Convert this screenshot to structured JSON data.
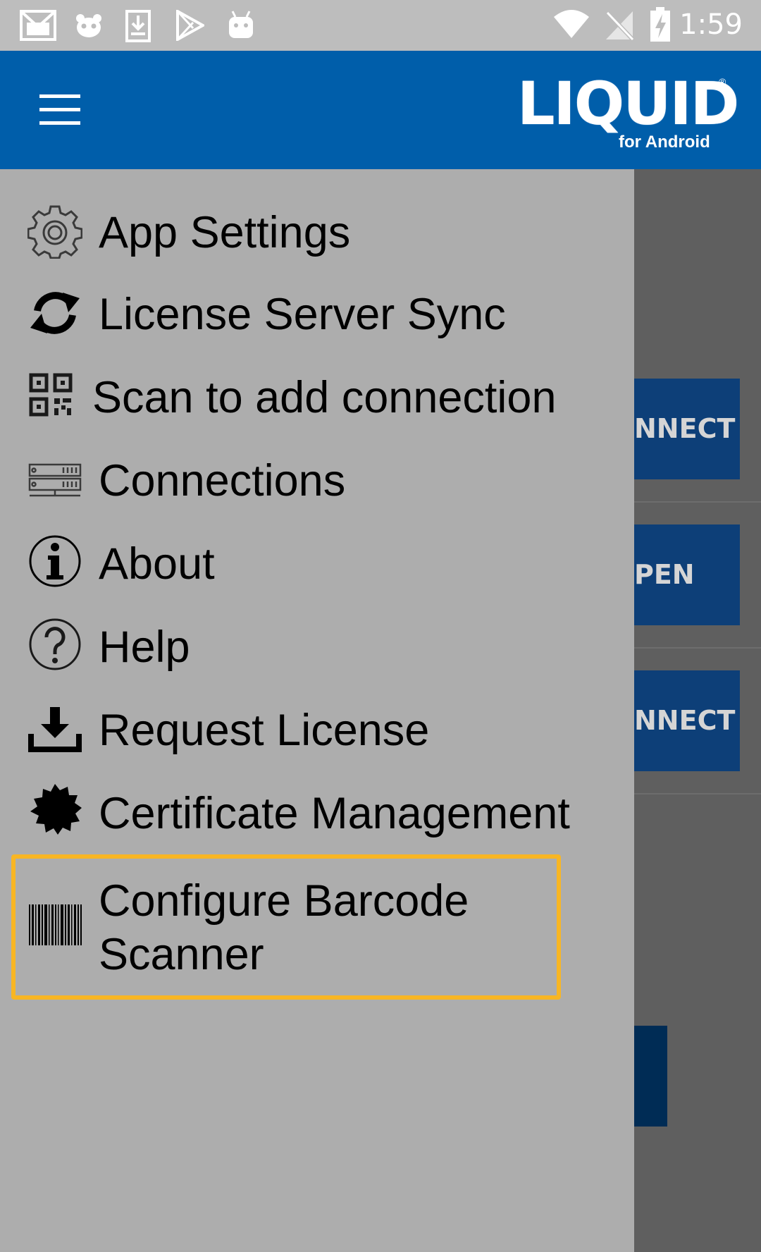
{
  "status_bar": {
    "time": "1:59",
    "icons": [
      "gmail-icon",
      "panda-icon",
      "download-icon",
      "play-store-icon",
      "android-icon",
      "wifi-icon",
      "no-signal-icon",
      "battery-charging-icon"
    ]
  },
  "app_bar": {
    "menu_icon": "hamburger-icon",
    "logo_text": "LIQUID",
    "logo_reg": "®",
    "logo_subtitle": "for Android"
  },
  "background": {
    "buttons": [
      {
        "label": "NNECT"
      },
      {
        "label": "PEN"
      },
      {
        "label": "NNECT"
      }
    ]
  },
  "drawer": {
    "items": [
      {
        "label": "App Settings",
        "icon": "gear-icon"
      },
      {
        "label": "License Server Sync",
        "icon": "sync-icon"
      },
      {
        "label": "Scan to add connection",
        "icon": "qr-code-icon"
      },
      {
        "label": "Connections",
        "icon": "server-icon"
      },
      {
        "label": "About",
        "icon": "info-icon"
      },
      {
        "label": "Help",
        "icon": "help-icon"
      },
      {
        "label": "Request License",
        "icon": "download-tray-icon"
      },
      {
        "label": "Certificate Management",
        "icon": "certificate-seal-icon"
      },
      {
        "label": "Configure Barcode Scanner",
        "icon": "barcode-icon"
      }
    ]
  },
  "colors": {
    "app_bar": "#005eaa",
    "drawer": "#adadad",
    "highlight": "#f8b624"
  }
}
